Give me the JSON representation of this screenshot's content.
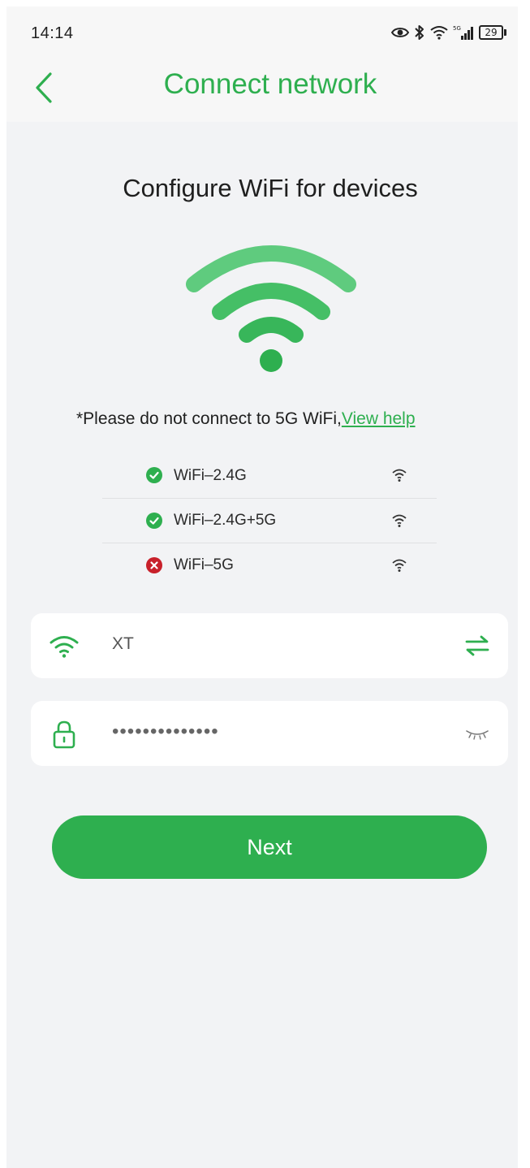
{
  "status_bar": {
    "time": "14:14",
    "battery": "29",
    "icons": [
      "eye-icon",
      "bluetooth-icon",
      "wifi-status-icon",
      "cellular-signal-icon",
      "battery-icon"
    ]
  },
  "header": {
    "title": "Connect network",
    "back_icon": "chevron-left-icon"
  },
  "main": {
    "heading": "Configure WiFi for devices",
    "notice_text": "*Please do not connect to 5G WiFi,",
    "help_link": "View help",
    "networks": [
      {
        "name": "WiFi–2.4G",
        "status": "supported",
        "status_icon": "check-circle-icon"
      },
      {
        "name": "WiFi–2.4G+5G",
        "status": "supported",
        "status_icon": "check-circle-icon"
      },
      {
        "name": "WiFi–5G",
        "status": "unsupported",
        "status_icon": "error-circle-icon"
      }
    ]
  },
  "form": {
    "ssid_value": "XT",
    "password_value": "••••••••••••••",
    "ssid_icon": "wifi-icon",
    "switch_icon": "switch-arrows-icon",
    "password_icon": "lock-icon",
    "visibility_icon": "eye-closed-icon"
  },
  "actions": {
    "next_label": "Next"
  },
  "colors": {
    "accent": "#2eaf4f",
    "error": "#c8202a",
    "background": "#f2f3f5"
  }
}
